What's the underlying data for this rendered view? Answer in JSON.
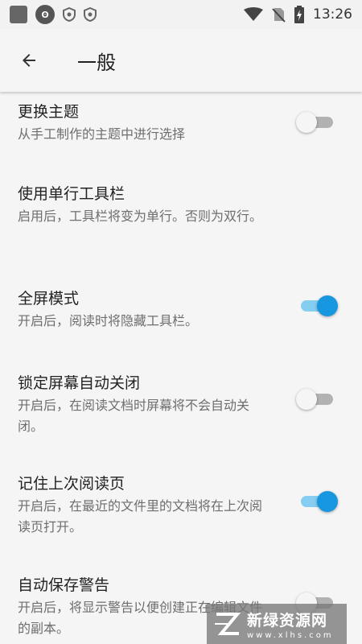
{
  "status_bar": {
    "time": "13:26",
    "icons": [
      "app-square-icon",
      "circle-app-icon",
      "shield-icon",
      "shield-icon",
      "wifi-icon",
      "no-signal-icon",
      "battery-charging-icon"
    ]
  },
  "app_bar": {
    "title": "一般",
    "back_icon": "arrow-back-icon"
  },
  "settings": [
    {
      "title": "更换主题",
      "summary": "从手工制作的主题中进行选择",
      "has_switch": false
    },
    {
      "title": "使用单行工具栏",
      "summary": "启用后，工具栏将变为单行。否则为双行。",
      "has_switch": true,
      "checked": false
    },
    {
      "title": "全屏模式",
      "summary": "开启后，阅读时将隐藏工具栏。",
      "has_switch": true,
      "checked": true
    },
    {
      "title": "锁定屏幕自动关闭",
      "summary": "开启后，在阅读文档时屏幕将不会自动关闭。",
      "has_switch": true,
      "checked": false
    },
    {
      "title": "记住上次阅读页",
      "summary": "开启后，在最近的文件里的文档将在上次阅读页打开。",
      "has_switch": true,
      "checked": true
    },
    {
      "title": "自动保存警告",
      "summary": "开启后，将显示警告以便创建正在编辑文件的副本。",
      "has_switch": true,
      "checked": false
    }
  ],
  "watermark": {
    "main": "新绿资源网",
    "sub": "www.xlhs.com"
  },
  "colors": {
    "accent": "#1697e0",
    "accent_track": "#86cdf2",
    "off_track": "#b2b2b2",
    "background": "#f5f5f5"
  }
}
